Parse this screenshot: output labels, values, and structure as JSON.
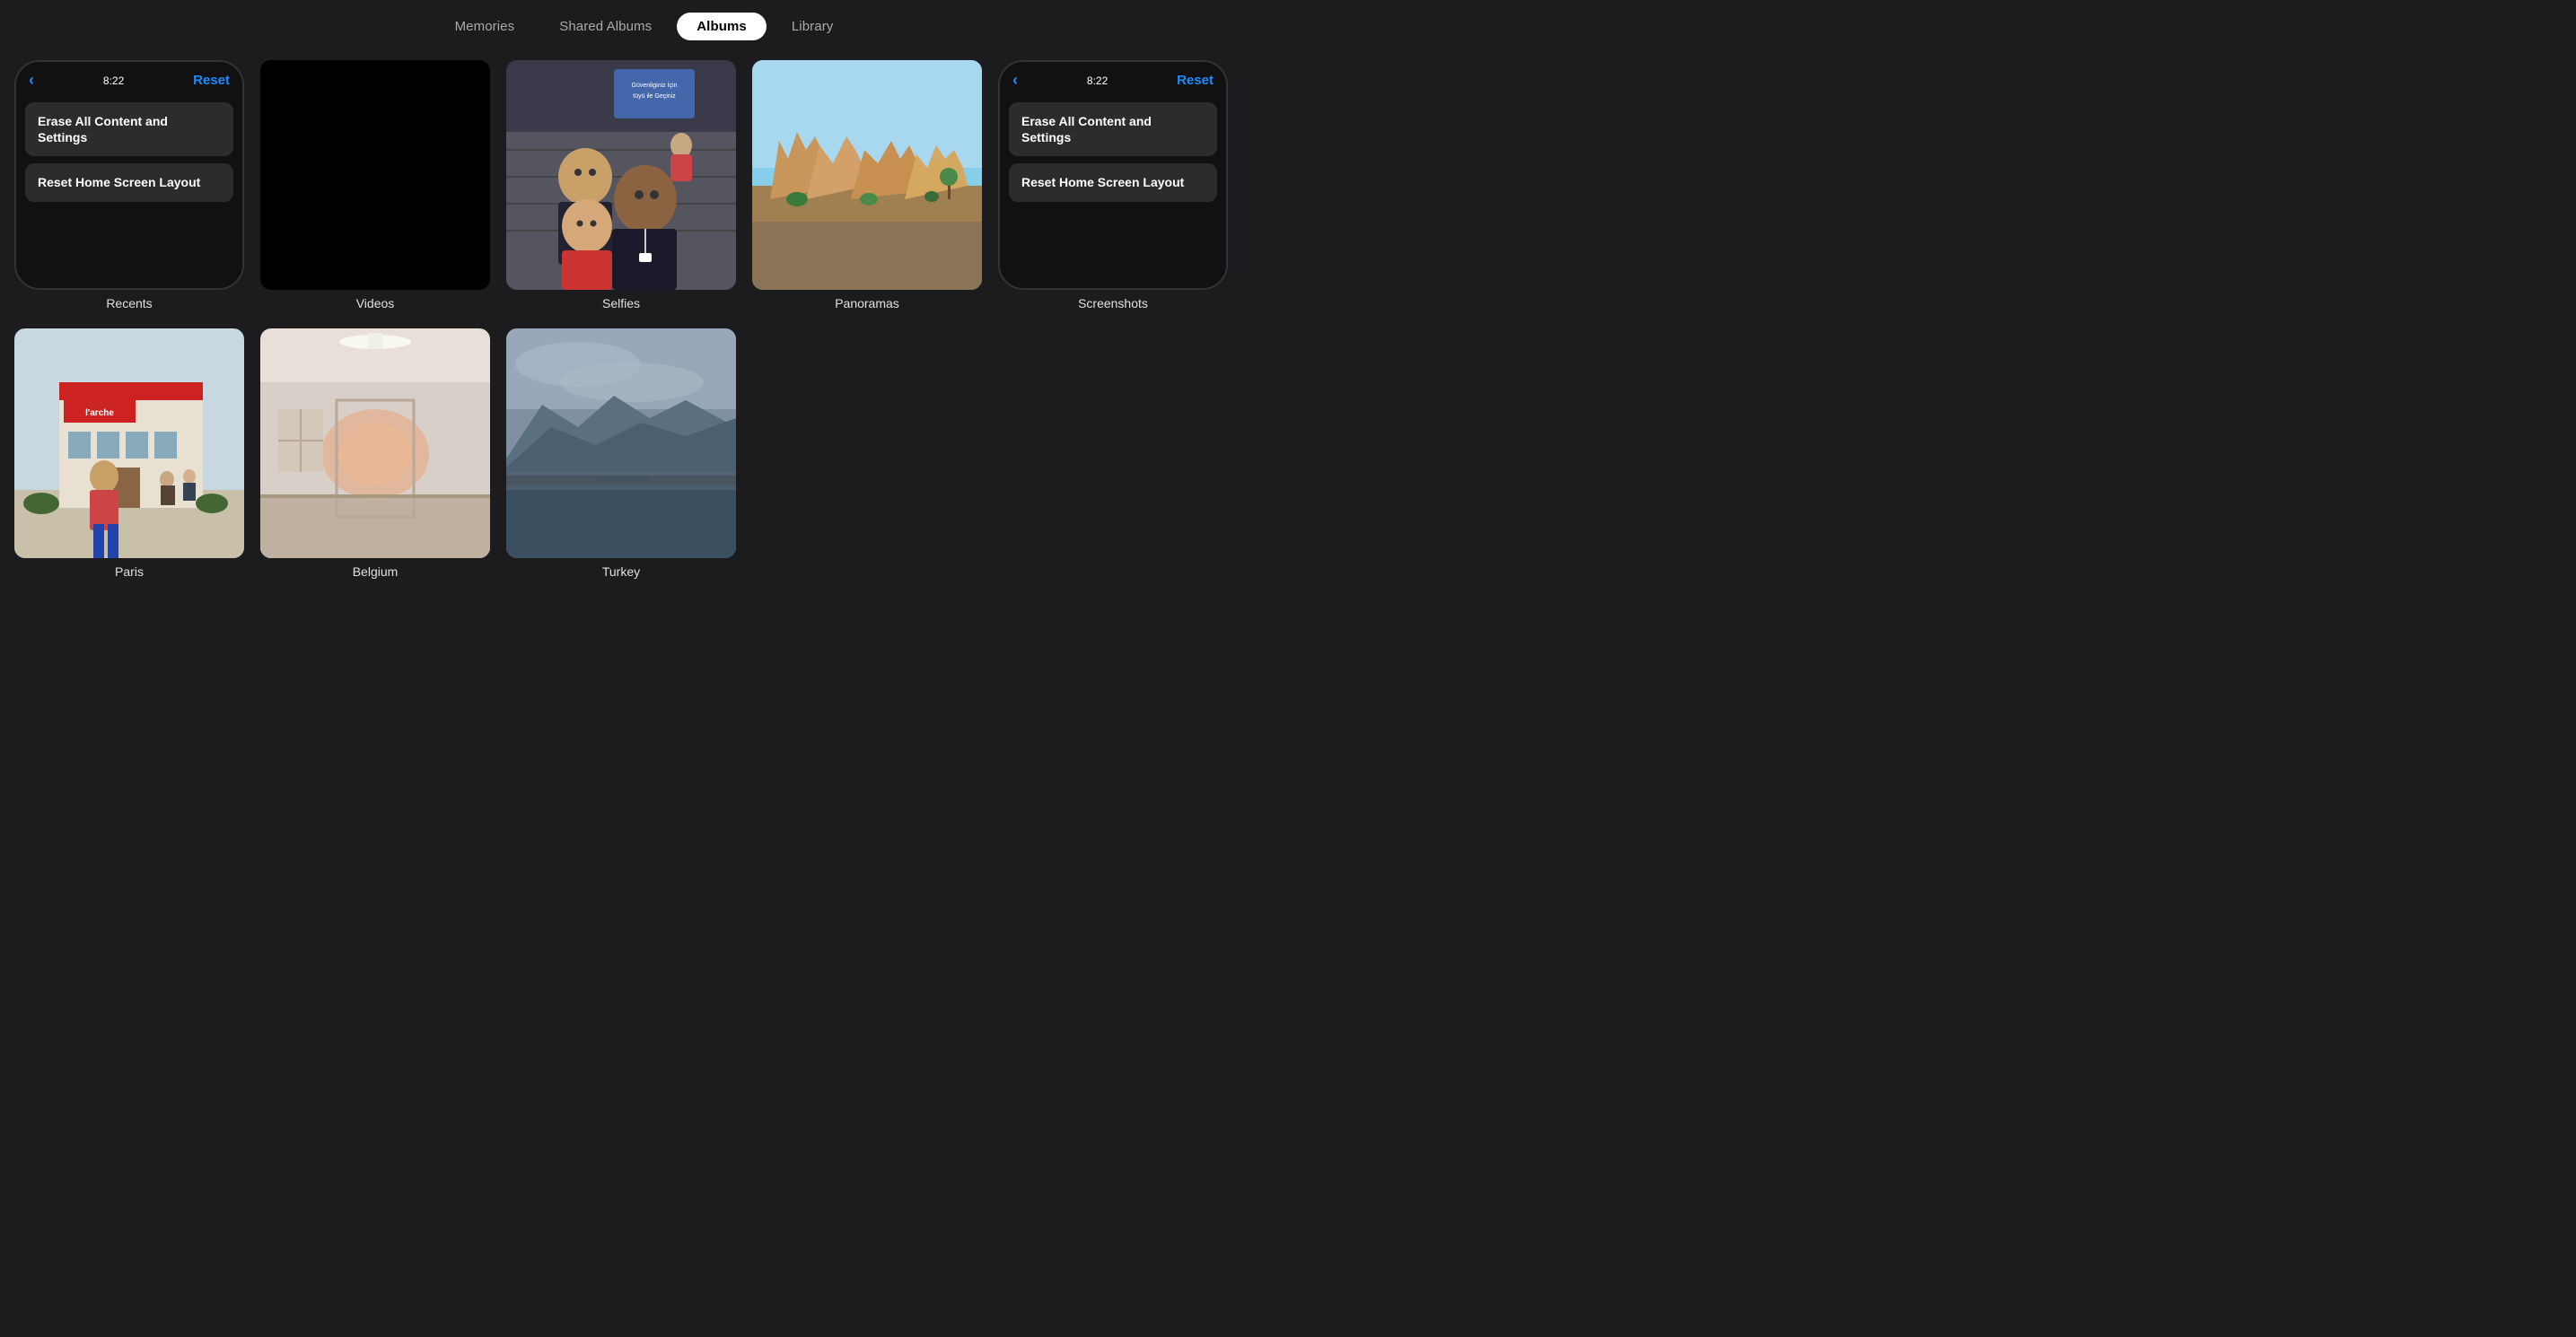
{
  "nav": {
    "tabs": [
      {
        "id": "memories",
        "label": "Memories",
        "active": false
      },
      {
        "id": "shared-albums",
        "label": "Shared Albums",
        "active": false
      },
      {
        "id": "albums",
        "label": "Albums",
        "active": true
      },
      {
        "id": "library",
        "label": "Library",
        "active": false
      }
    ]
  },
  "watch_tile_left": {
    "time": "8:22",
    "back_label": "‹",
    "reset_label": "Reset",
    "menu_items": [
      "Erase All Content and Settings",
      "Reset Home Screen Layout"
    ]
  },
  "watch_tile_right": {
    "time": "8:22",
    "back_label": "‹",
    "reset_label": "Reset",
    "menu_items": [
      "Erase All Content and Settings",
      "Reset Home Screen Layout"
    ]
  },
  "albums_row1": [
    {
      "id": "recents",
      "label": "Recents",
      "type": "watch"
    },
    {
      "id": "videos",
      "label": "Videos",
      "type": "videos"
    },
    {
      "id": "selfies",
      "label": "Selfies",
      "type": "selfie"
    },
    {
      "id": "panoramas",
      "label": "Panoramas",
      "type": "panorama"
    },
    {
      "id": "screenshots",
      "label": "Screenshots",
      "type": "watch"
    }
  ],
  "albums_row2": [
    {
      "id": "paris",
      "label": "Paris",
      "type": "paris"
    },
    {
      "id": "belgium",
      "label": "Belgium",
      "type": "belgium"
    },
    {
      "id": "turkey",
      "label": "Turkey",
      "type": "turkey"
    }
  ]
}
